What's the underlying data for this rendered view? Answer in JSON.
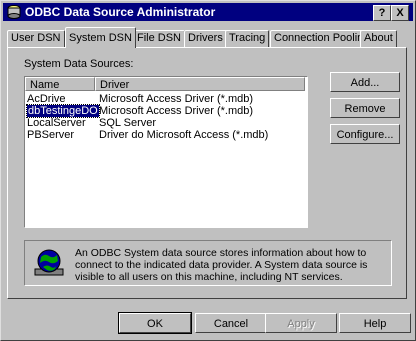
{
  "window": {
    "title": "ODBC Data Source Administrator",
    "help_btn": "?",
    "close_btn": "X"
  },
  "tabs": [
    "User DSN",
    "System DSN",
    "File DSN",
    "Drivers",
    "Tracing",
    "Connection Pooling",
    "About"
  ],
  "active_tab": "System DSN",
  "list": {
    "label": "System Data Sources:",
    "columns": {
      "name": "Name",
      "driver": "Driver"
    },
    "rows": [
      {
        "name": "AcDrive",
        "driver": "Microsoft Access Driver (*.mdb)"
      },
      {
        "name": "dbTestingeDO",
        "driver": "Microsoft Access Driver (*.mdb)"
      },
      {
        "name": "LocalServer",
        "driver": "SQL Server"
      },
      {
        "name": "PBServer",
        "driver": "Driver do Microsoft Access (*.mdb)"
      }
    ],
    "selected_index": 1
  },
  "side_buttons": {
    "add": "Add...",
    "remove": "Remove",
    "configure": "Configure..."
  },
  "info_text": "An ODBC System data source stores information about how to connect to the indicated data provider. A System data source is visible to all users on this machine, including NT services.",
  "footer": {
    "ok": "OK",
    "cancel": "Cancel",
    "apply": "Apply",
    "help": "Help"
  }
}
